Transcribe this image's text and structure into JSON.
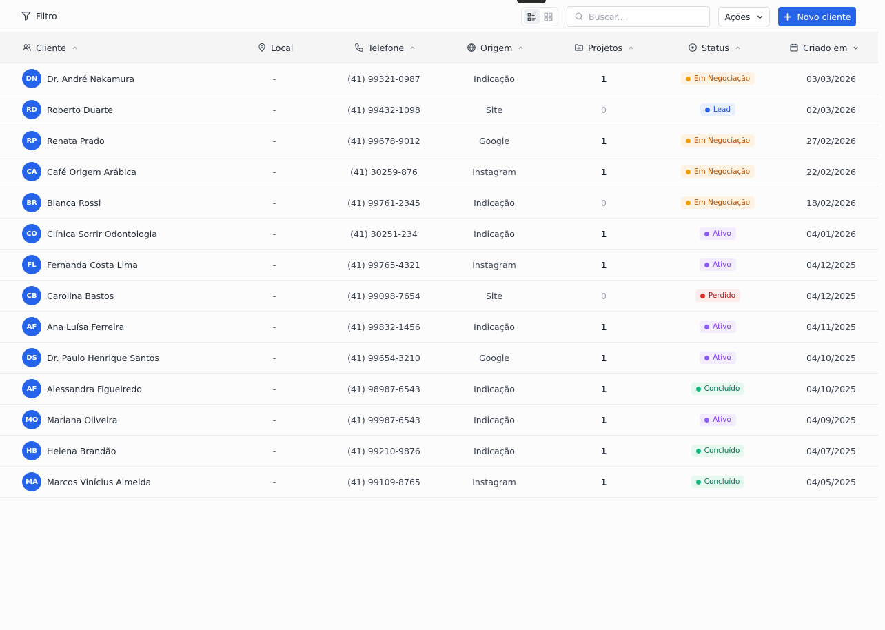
{
  "toolbar": {
    "filter_label": "Filtro",
    "search_placeholder": "Buscar...",
    "search_value": "",
    "actions_label": "Ações",
    "new_client_label": "Novo cliente",
    "active_view": "list"
  },
  "columns": {
    "client": "Cliente",
    "local": "Local",
    "phone": "Telefone",
    "origin": "Origem",
    "projects": "Projetos",
    "status": "Status",
    "created": "Criado em"
  },
  "status_styles": {
    "Em Negociação": {
      "text": "#b45309",
      "bg": "#fef3e2",
      "dot": "#f59e0b"
    },
    "Lead": {
      "text": "#1d4ed8",
      "bg": "#e8f0fe",
      "dot": "#2563eb"
    },
    "Ativo": {
      "text": "#7c3aed",
      "bg": "#f3ebfe",
      "dot": "#8b5cf6"
    },
    "Perdido": {
      "text": "#b91c1c",
      "bg": "#fdecec",
      "dot": "#dc2626"
    },
    "Concluído": {
      "text": "#047857",
      "bg": "#e7f8ef",
      "dot": "#10b981"
    }
  },
  "rows": [
    {
      "initials": "DN",
      "name": "Dr. André Nakamura",
      "local": "-",
      "phone": "(41) 99321-0987",
      "origin": "Indicação",
      "projects": "1",
      "status": "Em Negociação",
      "created": "03/03/2026"
    },
    {
      "initials": "RD",
      "name": "Roberto Duarte",
      "local": "-",
      "phone": "(41) 99432-1098",
      "origin": "Site",
      "projects": "0",
      "status": "Lead",
      "created": "02/03/2026"
    },
    {
      "initials": "RP",
      "name": "Renata Prado",
      "local": "-",
      "phone": "(41) 99678-9012",
      "origin": "Google",
      "projects": "1",
      "status": "Em Negociação",
      "created": "27/02/2026"
    },
    {
      "initials": "CA",
      "name": "Café Origem Arábica",
      "local": "-",
      "phone": "(41) 30259-876",
      "origin": "Instagram",
      "projects": "1",
      "status": "Em Negociação",
      "created": "22/02/2026"
    },
    {
      "initials": "BR",
      "name": "Bianca Rossi",
      "local": "-",
      "phone": "(41) 99761-2345",
      "origin": "Indicação",
      "projects": "0",
      "status": "Em Negociação",
      "created": "18/02/2026"
    },
    {
      "initials": "CO",
      "name": "Clínica Sorrir Odontologia",
      "local": "-",
      "phone": "(41) 30251-234",
      "origin": "Indicação",
      "projects": "1",
      "status": "Ativo",
      "created": "04/01/2026"
    },
    {
      "initials": "FL",
      "name": "Fernanda Costa Lima",
      "local": "-",
      "phone": "(41) 99765-4321",
      "origin": "Instagram",
      "projects": "1",
      "status": "Ativo",
      "created": "04/12/2025"
    },
    {
      "initials": "CB",
      "name": "Carolina Bastos",
      "local": "-",
      "phone": "(41) 99098-7654",
      "origin": "Site",
      "projects": "0",
      "status": "Perdido",
      "created": "04/12/2025"
    },
    {
      "initials": "AF",
      "name": "Ana Luísa Ferreira",
      "local": "-",
      "phone": "(41) 99832-1456",
      "origin": "Indicação",
      "projects": "1",
      "status": "Ativo",
      "created": "04/11/2025"
    },
    {
      "initials": "DS",
      "name": "Dr. Paulo Henrique Santos",
      "local": "-",
      "phone": "(41) 99654-3210",
      "origin": "Google",
      "projects": "1",
      "status": "Ativo",
      "created": "04/10/2025"
    },
    {
      "initials": "AF",
      "name": "Alessandra Figueiredo",
      "local": "-",
      "phone": "(41) 98987-6543",
      "origin": "Indicação",
      "projects": "1",
      "status": "Concluído",
      "created": "04/10/2025"
    },
    {
      "initials": "MO",
      "name": "Mariana Oliveira",
      "local": "-",
      "phone": "(41) 99987-6543",
      "origin": "Indicação",
      "projects": "1",
      "status": "Ativo",
      "created": "04/09/2025"
    },
    {
      "initials": "HB",
      "name": "Helena Brandão",
      "local": "-",
      "phone": "(41) 99210-9876",
      "origin": "Indicação",
      "projects": "1",
      "status": "Concluído",
      "created": "04/07/2025"
    },
    {
      "initials": "MA",
      "name": "Marcos Vinícius Almeida",
      "local": "-",
      "phone": "(41) 99109-8765",
      "origin": "Instagram",
      "projects": "1",
      "status": "Concluído",
      "created": "04/05/2025"
    }
  ]
}
